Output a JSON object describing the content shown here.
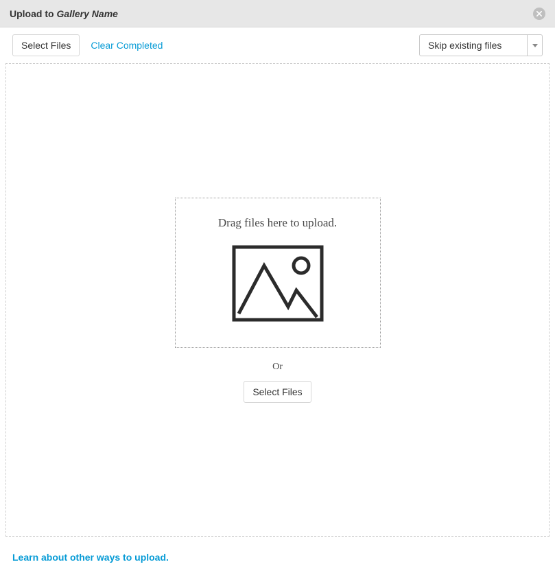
{
  "header": {
    "title_prefix": "Upload to ",
    "gallery_name": "Gallery Name"
  },
  "toolbar": {
    "select_files_label": "Select Files",
    "clear_completed_label": "Clear Completed",
    "dropdown_selected": "Skip existing files"
  },
  "dropzone": {
    "drag_label": "Drag files here to upload.",
    "or_label": "Or",
    "select_files_label": "Select Files"
  },
  "footer": {
    "link_label": "Learn about other ways to upload."
  }
}
